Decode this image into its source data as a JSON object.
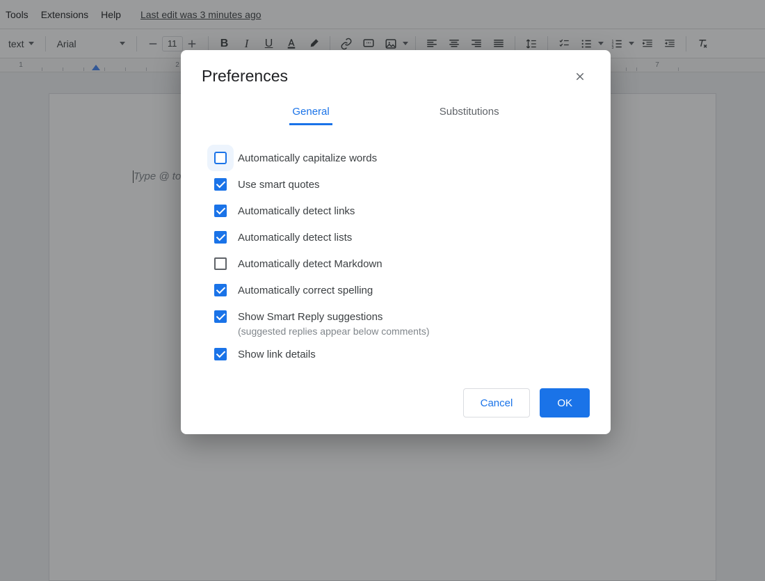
{
  "menubar": {
    "items": [
      "Tools",
      "Extensions",
      "Help"
    ],
    "last_edit": "Last edit was 3 minutes ago"
  },
  "toolbar": {
    "style_dropdown": "text",
    "font_dropdown": "Arial",
    "font_size": "11"
  },
  "ruler": {
    "marks": [
      "1",
      "2",
      "7"
    ]
  },
  "document": {
    "placeholder": "Type @ to inser"
  },
  "dialog": {
    "title": "Preferences",
    "tabs": {
      "general": "General",
      "substitutions": "Substitutions"
    },
    "prefs": [
      {
        "label": "Automatically capitalize words",
        "checked": false,
        "focus": true
      },
      {
        "label": "Use smart quotes",
        "checked": true
      },
      {
        "label": "Automatically detect links",
        "checked": true
      },
      {
        "label": "Automatically detect lists",
        "checked": true
      },
      {
        "label": "Automatically detect Markdown",
        "checked": false
      },
      {
        "label": "Automatically correct spelling",
        "checked": true
      },
      {
        "label": "Show Smart Reply suggestions",
        "checked": true,
        "sub": "(suggested replies appear below comments)"
      },
      {
        "label": "Show link details",
        "checked": true
      }
    ],
    "buttons": {
      "cancel": "Cancel",
      "ok": "OK"
    }
  }
}
